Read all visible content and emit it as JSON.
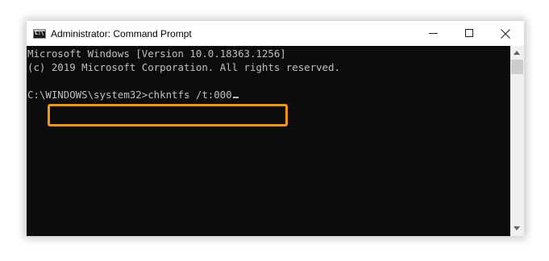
{
  "window": {
    "title": "Administrator: Command Prompt",
    "icon": "command-prompt-icon",
    "icon_text": "C:\\"
  },
  "caption_buttons": {
    "minimize_icon": "minimize-icon",
    "maximize_icon": "maximize-icon",
    "close_icon": "close-icon"
  },
  "console": {
    "line1": "Microsoft Windows [Version 10.0.18363.1256]",
    "line2": "(c) 2019 Microsoft Corporation. All rights reserved.",
    "prompt": "C:\\WINDOWS\\system32>",
    "command": "chkntfs /t:000"
  },
  "colors": {
    "console_background": "#0c0c0c",
    "console_text": "#c0c0c0",
    "highlight": "#f7941d"
  }
}
